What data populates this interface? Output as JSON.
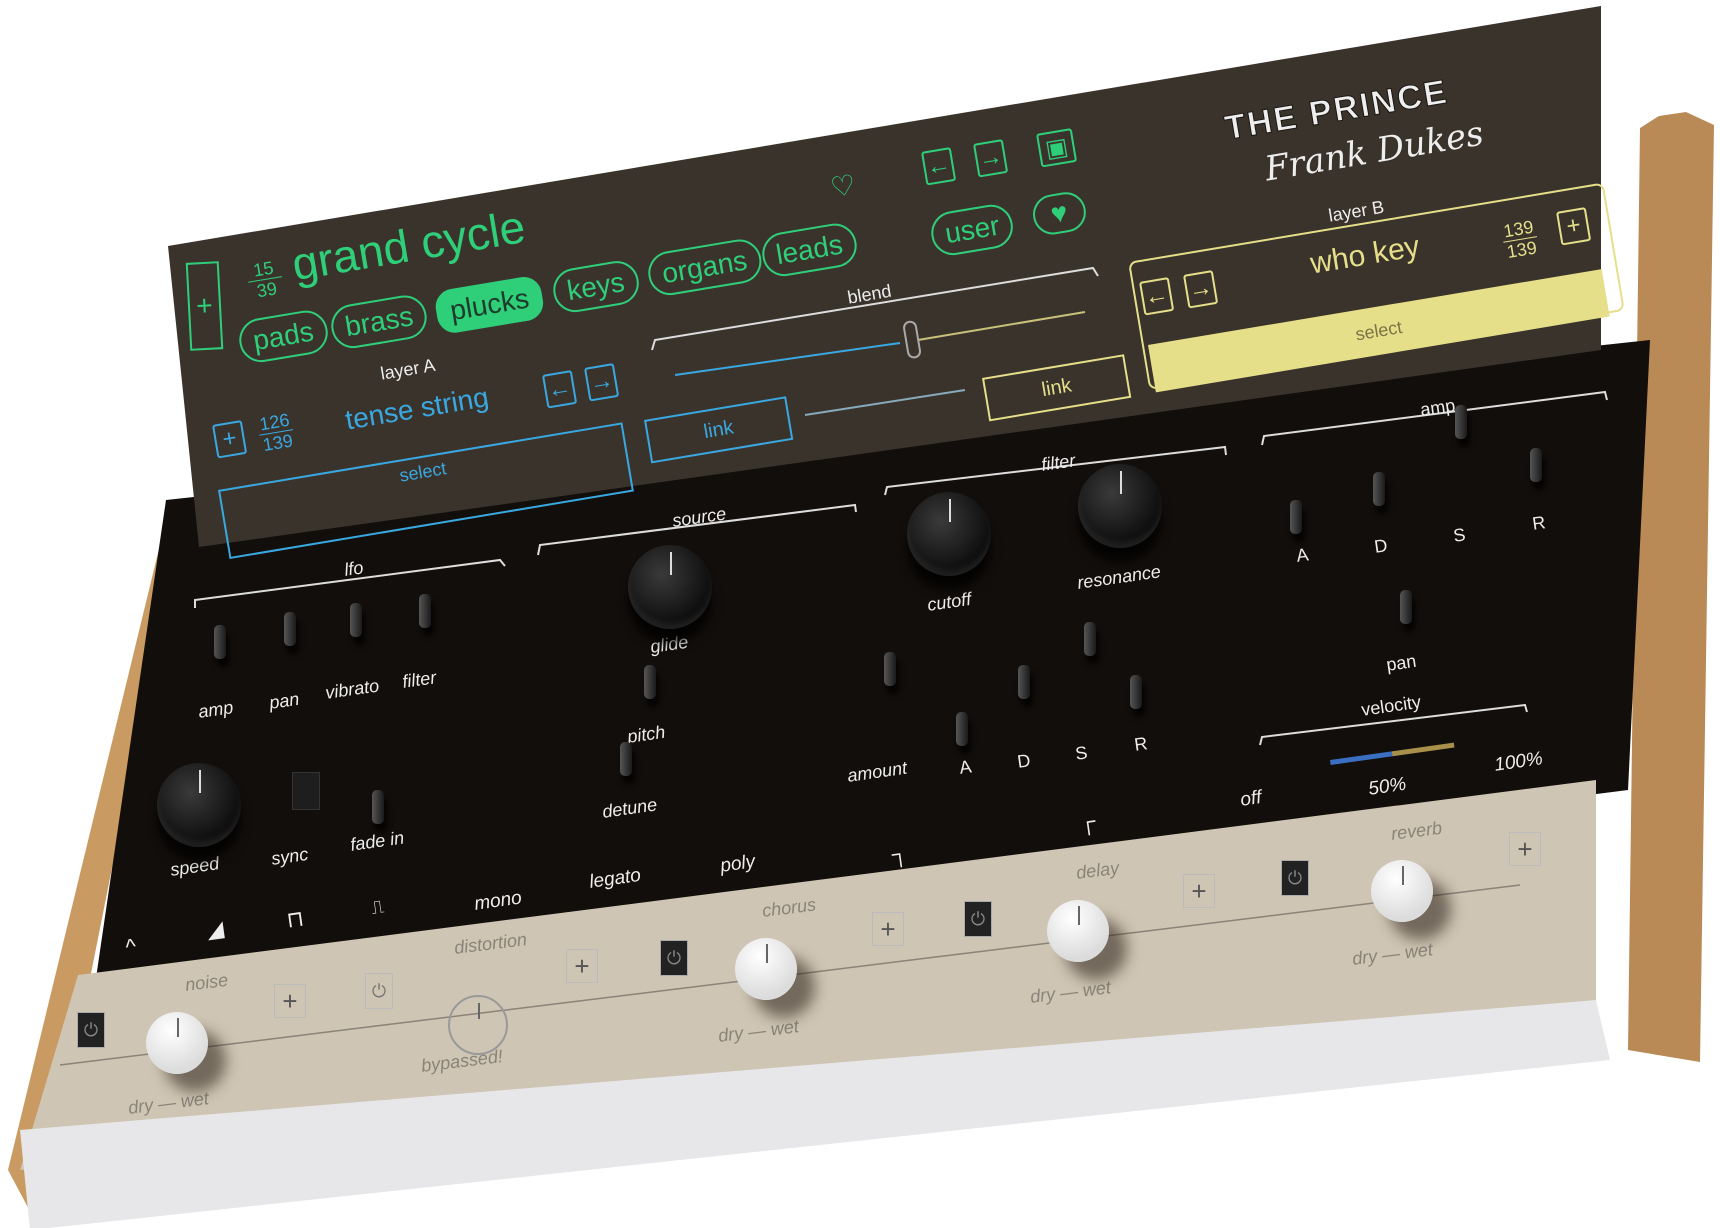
{
  "colors": {
    "layer_a": "#3aa8e0",
    "browser": "#2fcf7a",
    "layer_b": "#e6df8a",
    "screen": "#3a332c",
    "body": "#120e0b",
    "silver": "#c9bfae",
    "wood": "#b98a55"
  },
  "logo": {
    "title": "THE PRINCE",
    "signature": "Frank Dukes"
  },
  "browser": {
    "add_icon": "plus-icon",
    "counter": {
      "current": "15",
      "total": "39"
    },
    "preset_name": "grand cycle",
    "favorite_icon": "heart-outline-icon",
    "prev_icon": "arrow-left-icon",
    "next_icon": "arrow-right-icon",
    "save_icon": "floppy-disk-icon",
    "categories": [
      {
        "label": "pads"
      },
      {
        "label": "brass"
      },
      {
        "label": "plucks",
        "active": true
      },
      {
        "label": "keys"
      },
      {
        "label": "organs"
      },
      {
        "label": "leads"
      }
    ],
    "user_label": "user",
    "favorites_icon": "heart-filled-icon"
  },
  "layer_a": {
    "label": "layer A",
    "preset": "tense string",
    "counter": {
      "current": "126",
      "total": "139"
    },
    "select": "select",
    "link": "link"
  },
  "layer_b": {
    "label": "layer B",
    "preset": "who key",
    "counter": {
      "current": "139",
      "total": "139"
    },
    "select": "select",
    "link": "link"
  },
  "blend": {
    "label": "blend"
  },
  "lfo": {
    "title": "lfo",
    "targets": [
      "amp",
      "pan",
      "vibrato",
      "filter"
    ],
    "speed": "speed",
    "sync": "sync",
    "fade_in": "fade in",
    "waveforms": [
      "triangle-wave-icon",
      "saw-wave-icon",
      "square-wave-icon",
      "pulse-wave-icon"
    ]
  },
  "source": {
    "title": "source",
    "glide": "glide",
    "pitch": "pitch",
    "detune": "detune",
    "modes": [
      "mono",
      "legato",
      "poly"
    ]
  },
  "filter": {
    "title": "filter",
    "cutoff": "cutoff",
    "resonance": "resonance",
    "amount": "amount",
    "adsr": [
      "A",
      "D",
      "S",
      "R"
    ],
    "shapes": [
      "lowpass-shape-icon",
      "highpass-shape-icon"
    ]
  },
  "amp": {
    "title": "amp",
    "adsr": [
      "A",
      "D",
      "S",
      "R"
    ],
    "pan": "pan"
  },
  "velocity": {
    "title": "velocity",
    "options": [
      "off",
      "50%",
      "100%"
    ]
  },
  "effects": {
    "noise": {
      "title": "noise",
      "mix": "dry — wet"
    },
    "distortion": {
      "title": "distortion",
      "status": "bypassed!"
    },
    "chorus": {
      "title": "chorus",
      "mix": "dry — wet"
    },
    "delay": {
      "title": "delay",
      "mix": "dry — wet"
    },
    "reverb": {
      "title": "reverb",
      "mix": "dry — wet"
    }
  }
}
